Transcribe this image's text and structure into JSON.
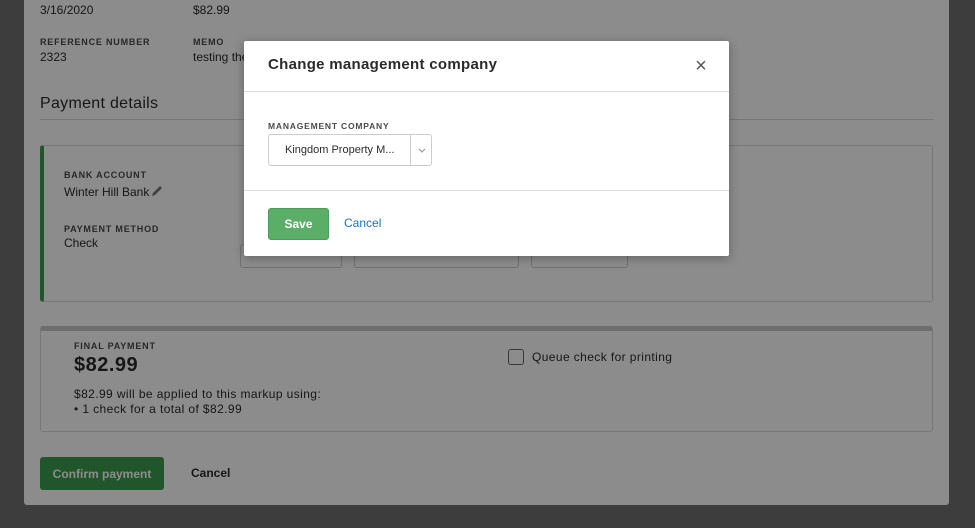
{
  "top_row": {
    "date": "3/16/2020",
    "amount": "$82.99"
  },
  "reference": {
    "label": "REFERENCE NUMBER",
    "value": "2323"
  },
  "memo": {
    "label": "MEMO",
    "value": "testing the"
  },
  "payment_details": {
    "title": "Payment details",
    "bank_account_label": "BANK ACCOUNT",
    "bank_account_value": "Winter Hill Bank",
    "payment_method_label": "PAYMENT METHOD",
    "payment_method_value": "Check"
  },
  "final_payment": {
    "label": "FINAL PAYMENT",
    "amount": "$82.99",
    "summary_line1": "$82.99 will be applied to this markup using:",
    "summary_line2": "• 1 check for a total of $82.99",
    "queue_label": "Queue check for printing",
    "queue_checked": false
  },
  "actions": {
    "confirm_label": "Confirm payment",
    "cancel_label": "Cancel"
  },
  "modal": {
    "title": "Change management company",
    "close_glyph": "×",
    "field_label": "MANAGEMENT COMPANY",
    "selected_value": "Kingdom Property M...",
    "save_label": "Save",
    "cancel_label": "Cancel"
  },
  "colors": {
    "primary_green": "#3d9b4f",
    "save_green": "#5aae68",
    "link_blue": "#1a73c4"
  }
}
